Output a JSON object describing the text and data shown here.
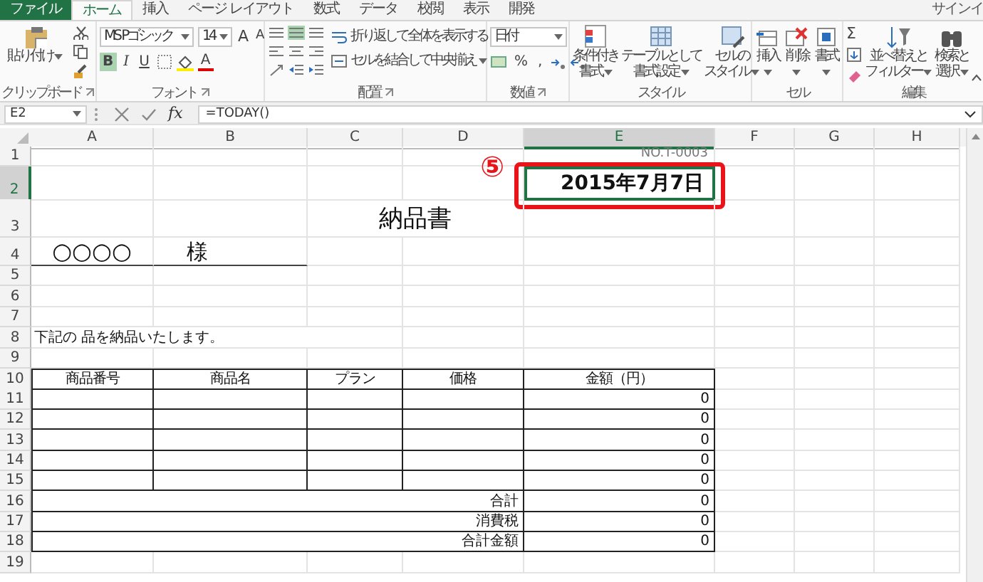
{
  "ribbon_tabs": [
    {
      "label": "ファイル",
      "kind": "file",
      "selected": false
    },
    {
      "label": "ホーム",
      "kind": "tab",
      "selected": true
    },
    {
      "label": "挿入",
      "kind": "tab",
      "selected": false
    },
    {
      "label": "ページ レイアウト",
      "kind": "tab",
      "selected": false
    },
    {
      "label": "数式",
      "kind": "tab",
      "selected": false
    },
    {
      "label": "データ",
      "kind": "tab",
      "selected": false
    },
    {
      "label": "校閲",
      "kind": "tab",
      "selected": false
    },
    {
      "label": "表示",
      "kind": "tab",
      "selected": false
    },
    {
      "label": "開発",
      "kind": "tab",
      "selected": false
    }
  ],
  "sign_in": "サインイ",
  "ribbon_groups": [
    {
      "kind": "clipboard",
      "label": "クリップボード",
      "paste": "貼り付け"
    },
    {
      "kind": "font",
      "label": "フォント",
      "font_name": "MS Pゴシック",
      "font_size": "14",
      "grow": "A",
      "shrink": "A",
      "bold": "B",
      "italic": "I",
      "underline": "U",
      "font_color": "A",
      "bold_on": true
    },
    {
      "kind": "alignment",
      "label": "配置",
      "wrap_text": "折り返して全体を表示する",
      "merge": "セルを結合して中央揃え",
      "middle_on": true
    },
    {
      "kind": "number",
      "label": "数値",
      "format": "日付",
      "percent": "%",
      "comma": ","
    },
    {
      "kind": "styles",
      "label": "スタイル",
      "buttons": [
        {
          "lines": [
            "条件付き",
            "書式"
          ]
        },
        {
          "lines": [
            "テーブルとして",
            "書式設定"
          ]
        },
        {
          "lines": [
            "セルの",
            "スタイル"
          ]
        }
      ]
    },
    {
      "kind": "cells",
      "label": "セル",
      "buttons": [
        {
          "lines": [
            "挿入"
          ]
        },
        {
          "lines": [
            "削除"
          ]
        },
        {
          "lines": [
            "書式"
          ]
        }
      ]
    },
    {
      "kind": "editing",
      "label": "編集",
      "sum": "Σ",
      "buttons": [
        {
          "lines": [
            "並べ替えと",
            "フィルター"
          ]
        },
        {
          "lines": [
            "検索と",
            "選択"
          ]
        }
      ]
    }
  ],
  "formula_bar": {
    "name_box": "E2",
    "function_key": "fx",
    "formula": "=TODAY()"
  },
  "columns": [
    {
      "label": "A",
      "selected": false
    },
    {
      "label": "B",
      "selected": false
    },
    {
      "label": "C",
      "selected": false
    },
    {
      "label": "D",
      "selected": false
    },
    {
      "label": "E",
      "selected": true
    },
    {
      "label": "F",
      "selected": false
    },
    {
      "label": "G",
      "selected": false
    },
    {
      "label": "H",
      "selected": false
    }
  ],
  "rows": [
    {
      "number": "1",
      "kind": "plain",
      "selected": false,
      "cells": {
        "E": {
          "kind": "note-right",
          "text": "NO.T-0003"
        }
      }
    },
    {
      "number": "2",
      "kind": "plain",
      "selected": true,
      "cells": {
        "E": {
          "kind": "date",
          "text": "2015年7月7日",
          "active": true
        }
      }
    },
    {
      "number": "3",
      "kind": "plain",
      "selected": false,
      "cells": {
        "C": {
          "kind": "title",
          "text": "納品書"
        }
      }
    },
    {
      "number": "4",
      "kind": "addressee",
      "selected": false,
      "cells": {
        "A": {
          "kind": "addressee",
          "text": "○○○○"
        },
        "B": {
          "kind": "honorific",
          "text": "様"
        }
      }
    },
    {
      "number": "5",
      "kind": "plain",
      "selected": false
    },
    {
      "number": "6",
      "kind": "plain",
      "selected": false
    },
    {
      "number": "7",
      "kind": "plain",
      "selected": false
    },
    {
      "number": "8",
      "kind": "plain",
      "selected": false,
      "cells": {
        "A": {
          "kind": "text",
          "text": "下記の 品を納品いたします。"
        }
      }
    },
    {
      "number": "9",
      "kind": "plain",
      "selected": false
    },
    {
      "number": "10",
      "kind": "table-header",
      "selected": false,
      "cells": {
        "A": {
          "kind": "heading",
          "text": "商品番号"
        },
        "B": {
          "kind": "heading",
          "text": "商品名"
        },
        "C": {
          "kind": "heading",
          "text": "プラン"
        },
        "D": {
          "kind": "heading",
          "text": "価格"
        },
        "E": {
          "kind": "heading",
          "text": "金額（円）"
        }
      }
    },
    {
      "number": "11",
      "kind": "table-row",
      "selected": false,
      "cells": {
        "E": {
          "kind": "number",
          "text": "0"
        }
      }
    },
    {
      "number": "12",
      "kind": "table-row",
      "selected": false,
      "cells": {
        "E": {
          "kind": "number",
          "text": "0"
        }
      }
    },
    {
      "number": "13",
      "kind": "table-row",
      "selected": false,
      "cells": {
        "E": {
          "kind": "number",
          "text": "0"
        }
      }
    },
    {
      "number": "14",
      "kind": "table-row",
      "selected": false,
      "cells": {
        "E": {
          "kind": "number",
          "text": "0"
        }
      }
    },
    {
      "number": "15",
      "kind": "table-row",
      "selected": false,
      "cells": {
        "E": {
          "kind": "number",
          "text": "0"
        }
      }
    },
    {
      "number": "16",
      "kind": "total",
      "selected": false,
      "cells": {
        "D": {
          "kind": "total-label",
          "text": "合計"
        },
        "E": {
          "kind": "number",
          "text": "0"
        }
      }
    },
    {
      "number": "17",
      "kind": "total",
      "selected": false,
      "cells": {
        "D": {
          "kind": "total-label",
          "text": "消費税"
        },
        "E": {
          "kind": "number",
          "text": "0"
        }
      }
    },
    {
      "number": "18",
      "kind": "total",
      "selected": false,
      "cells": {
        "D": {
          "kind": "total-label",
          "text": "合計金額"
        },
        "E": {
          "kind": "number",
          "text": "0"
        }
      }
    },
    {
      "number": "19",
      "kind": "plain",
      "selected": false
    }
  ],
  "annotation": {
    "marker": "⑤"
  }
}
